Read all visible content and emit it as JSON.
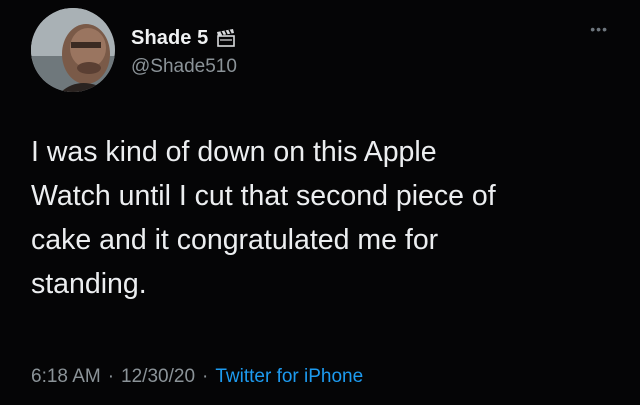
{
  "user": {
    "display_name": "Shade 5",
    "handle": "@Shade510",
    "badge_icon": "clapperboard-icon"
  },
  "menu": {
    "icon": "more-dots-icon"
  },
  "tweet": {
    "text": "I was kind of down on this Apple\nWatch until I cut that second piece of\ncake and it congratulated me for\nstanding."
  },
  "meta": {
    "time": "6:18 AM",
    "separator": "·",
    "date": "12/30/20",
    "source": "Twitter for iPhone"
  },
  "colors": {
    "background": "#050506",
    "text": "#eceef0",
    "secondary": "#8b9398",
    "link": "#1d9bf0"
  }
}
